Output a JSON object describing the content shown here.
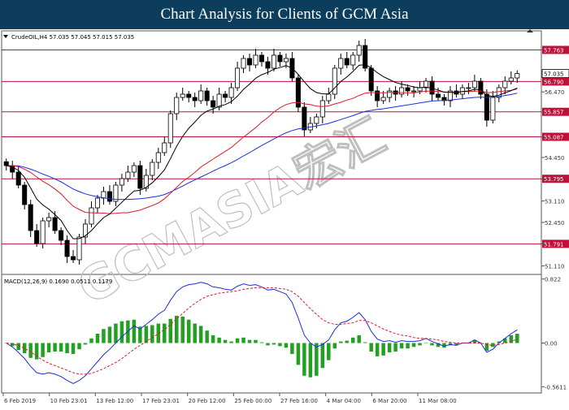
{
  "header": {
    "title": "Chart Analysis for Clients of GCM Asia"
  },
  "watermark": {
    "text": "GCMASIA宏汇"
  },
  "colors": {
    "ma_fast": "#000000",
    "ma_mid": "#e0182c",
    "ma_slow": "#1a2ee0",
    "level_line": "#c0103a",
    "macd_hist": "#22a022",
    "macd_line": "#1a2ee0",
    "macd_signal": "#e0182c",
    "label_bg": "#c0103a",
    "current_bg": "#ffffff"
  },
  "chart_data": [
    {
      "type": "candlestick",
      "instrument_info": "CrudeOIL,H4  57.035 57.045 57.015 57.035",
      "ylim": [
        50.9,
        58.3
      ],
      "y_ticks": [
        51.11,
        51.79,
        52.45,
        53.11,
        53.79,
        54.45,
        55.08,
        55.85,
        56.47,
        57.035,
        57.76
      ],
      "y_tick_labels": [
        "51.110",
        "51.791",
        "52.450",
        "53.110",
        "53.795",
        "54.450",
        "55.087",
        "55.857",
        "56.470",
        "57.035",
        "57.763"
      ],
      "x_tick_labels": [
        "6 Feb 2019",
        "10 Feb 23:01",
        "13 Feb 12:00",
        "17 Feb 23:01",
        "20 Feb 12:00",
        "25 Feb 00:00",
        "27 Feb 16:00",
        "4 Mar 04:00",
        "6 Mar 20:00",
        "11 Mar 08:00"
      ],
      "levels": [
        {
          "value": 57.763,
          "label": "57.763"
        },
        {
          "value": 56.79,
          "label": "56.790"
        },
        {
          "value": 55.857,
          "label": "55.857"
        },
        {
          "value": 55.087,
          "label": "55.087"
        },
        {
          "value": 53.795,
          "label": "53.795"
        },
        {
          "value": 51.791,
          "label": "51.791"
        }
      ],
      "current_price": {
        "value": 57.035,
        "label": "57.035"
      },
      "close": [
        54.2,
        54.0,
        53.6,
        53.0,
        52.2,
        51.8,
        52.5,
        52.6,
        52.2,
        51.9,
        51.4,
        51.3,
        52.0,
        52.4,
        52.9,
        53.2,
        53.4,
        53.1,
        53.6,
        53.8,
        54.0,
        54.2,
        53.5,
        53.9,
        54.3,
        54.6,
        54.9,
        55.8,
        56.3,
        56.4,
        56.3,
        56.2,
        56.5,
        56.2,
        56.0,
        56.4,
        56.3,
        56.6,
        57.2,
        57.5,
        57.3,
        57.6,
        57.4,
        57.2,
        57.6,
        57.4,
        57.5,
        56.9,
        56.0,
        55.3,
        55.5,
        55.7,
        56.2,
        56.4,
        57.2,
        57.5,
        57.3,
        57.6,
        57.9,
        57.2,
        56.5,
        56.2,
        56.3,
        56.5,
        56.4,
        56.6,
        56.5,
        56.5,
        56.6,
        56.8,
        56.4,
        56.3,
        56.2,
        56.5,
        56.4,
        56.6,
        56.6,
        56.8,
        56.4,
        55.6,
        56.3,
        56.6,
        56.8,
        56.9,
        57.035
      ],
      "ma_fast": [
        54.2,
        54.16,
        54.05,
        53.84,
        53.51,
        53.17,
        52.99,
        52.86,
        52.69,
        52.51,
        52.2,
        51.95,
        51.95,
        52.04,
        52.2,
        52.41,
        52.6,
        52.71,
        52.89,
        53.07,
        53.25,
        53.42,
        53.44,
        53.53,
        53.67,
        53.86,
        54.07,
        54.42,
        54.79,
        55.1,
        55.35,
        55.54,
        55.75,
        55.88,
        55.94,
        56.03,
        56.08,
        56.17,
        56.34,
        56.55,
        56.71,
        56.89,
        57.0,
        57.07,
        57.17,
        57.22,
        57.28,
        57.2,
        57.01,
        56.78,
        56.57,
        56.45,
        56.41,
        56.41,
        56.59,
        56.79,
        56.93,
        57.1,
        57.29,
        57.31,
        57.21,
        57.06,
        56.94,
        56.85,
        56.76,
        56.71,
        56.67,
        56.62,
        56.6,
        56.62,
        56.58,
        56.53,
        56.46,
        56.46,
        56.45,
        56.48,
        56.5,
        56.55,
        56.54,
        56.36,
        56.33,
        56.37,
        56.44,
        56.51,
        56.59
      ],
      "ma_mid": [
        54.2,
        54.2,
        54.17,
        54.09,
        53.99,
        53.85,
        53.72,
        53.61,
        53.48,
        53.33,
        53.13,
        52.95,
        52.85,
        52.76,
        52.75,
        52.74,
        52.74,
        52.72,
        52.73,
        52.75,
        52.75,
        52.79,
        52.83,
        52.9,
        52.97,
        53.05,
        53.18,
        53.35,
        53.53,
        53.71,
        53.84,
        53.99,
        54.16,
        54.28,
        54.4,
        54.52,
        54.64,
        54.76,
        54.92,
        55.08,
        55.22,
        55.37,
        55.54,
        55.68,
        55.85,
        55.98,
        56.08,
        56.13,
        56.15,
        56.1,
        56.08,
        56.03,
        56.02,
        56.04,
        56.1,
        56.15,
        56.22,
        56.27,
        56.36,
        56.43,
        56.45,
        56.45,
        56.44,
        56.46,
        56.45,
        56.45,
        56.44,
        56.44,
        56.47,
        56.49,
        56.5,
        56.48,
        56.47,
        56.46,
        56.46,
        56.48,
        56.48,
        56.49,
        56.5,
        56.45,
        56.45,
        56.48,
        56.5,
        56.52,
        56.56
      ],
      "ma_slow": [
        54.2,
        54.2,
        54.19,
        54.15,
        54.09,
        54.02,
        53.94,
        53.87,
        53.79,
        53.7,
        53.59,
        53.48,
        53.4,
        53.33,
        53.28,
        53.24,
        53.21,
        53.18,
        53.16,
        53.16,
        53.16,
        53.17,
        53.18,
        53.2,
        53.23,
        53.26,
        53.31,
        53.39,
        53.48,
        53.57,
        53.67,
        53.76,
        53.85,
        53.94,
        54.03,
        54.12,
        54.2,
        54.29,
        54.39,
        54.5,
        54.6,
        54.71,
        54.82,
        54.92,
        55.02,
        55.12,
        55.21,
        55.28,
        55.33,
        55.36,
        55.39,
        55.42,
        55.46,
        55.5,
        55.56,
        55.62,
        55.68,
        55.74,
        55.81,
        55.87,
        55.9,
        55.93,
        55.95,
        55.98,
        56.01,
        56.04,
        56.07,
        56.1,
        56.13,
        56.16,
        56.19,
        56.2,
        56.21,
        56.22,
        56.24,
        56.26,
        56.28,
        56.3,
        56.31,
        56.3,
        56.31,
        56.33,
        56.36,
        56.39,
        56.43
      ]
    },
    {
      "type": "macd",
      "label": "MACD(12,26,9)  0.1690  0.0511  0.1179",
      "ylim": [
        -0.62,
        0.86
      ],
      "y_ticks": [
        0.822,
        0.0,
        -0.5611
      ],
      "y_tick_labels": [
        "0.822",
        "0.00",
        "-0.5611"
      ],
      "macd": [
        0.0,
        -0.05,
        -0.12,
        -0.2,
        -0.3,
        -0.38,
        -0.4,
        -0.38,
        -0.4,
        -0.43,
        -0.48,
        -0.52,
        -0.48,
        -0.42,
        -0.33,
        -0.24,
        -0.15,
        -0.08,
        0.0,
        0.08,
        0.15,
        0.22,
        0.18,
        0.24,
        0.3,
        0.37,
        0.42,
        0.55,
        0.66,
        0.72,
        0.75,
        0.76,
        0.78,
        0.76,
        0.72,
        0.71,
        0.69,
        0.68,
        0.73,
        0.76,
        0.74,
        0.75,
        0.72,
        0.68,
        0.69,
        0.66,
        0.63,
        0.52,
        0.32,
        0.1,
        0.0,
        -0.05,
        -0.02,
        0.04,
        0.17,
        0.26,
        0.28,
        0.33,
        0.39,
        0.3,
        0.15,
        0.05,
        0.02,
        0.03,
        0.01,
        0.03,
        0.02,
        0.02,
        0.03,
        0.06,
        0.02,
        -0.01,
        -0.04,
        -0.02,
        -0.03,
        0.0,
        0.0,
        0.04,
        0.0,
        -0.12,
        -0.08,
        0.0,
        0.06,
        0.12,
        0.169
      ],
      "signal": [
        0.0,
        -0.01,
        -0.03,
        -0.07,
        -0.11,
        -0.17,
        -0.22,
        -0.26,
        -0.29,
        -0.32,
        -0.35,
        -0.38,
        -0.4,
        -0.4,
        -0.39,
        -0.36,
        -0.33,
        -0.29,
        -0.25,
        -0.2,
        -0.14,
        -0.08,
        -0.03,
        0.02,
        0.07,
        0.12,
        0.17,
        0.24,
        0.31,
        0.38,
        0.45,
        0.51,
        0.56,
        0.6,
        0.62,
        0.64,
        0.65,
        0.66,
        0.67,
        0.69,
        0.7,
        0.71,
        0.71,
        0.71,
        0.71,
        0.7,
        0.69,
        0.66,
        0.6,
        0.52,
        0.44,
        0.37,
        0.3,
        0.26,
        0.24,
        0.24,
        0.25,
        0.26,
        0.29,
        0.29,
        0.26,
        0.22,
        0.18,
        0.15,
        0.12,
        0.1,
        0.09,
        0.07,
        0.06,
        0.06,
        0.05,
        0.04,
        0.02,
        0.01,
        0.0,
        0.0,
        0.0,
        0.0,
        0.0,
        -0.02,
        -0.03,
        -0.02,
        0.0,
        0.02,
        0.05
      ],
      "histogram": [
        0.0,
        -0.04,
        -0.09,
        -0.13,
        -0.19,
        -0.21,
        -0.18,
        -0.12,
        -0.11,
        -0.11,
        -0.13,
        -0.14,
        -0.08,
        -0.02,
        0.06,
        0.12,
        0.18,
        0.21,
        0.25,
        0.28,
        0.29,
        0.3,
        0.21,
        0.22,
        0.23,
        0.25,
        0.25,
        0.31,
        0.35,
        0.34,
        0.3,
        0.25,
        0.22,
        0.16,
        0.1,
        0.07,
        0.04,
        0.02,
        0.06,
        0.07,
        0.04,
        0.04,
        0.01,
        -0.03,
        -0.02,
        -0.04,
        -0.06,
        -0.14,
        -0.28,
        -0.42,
        -0.44,
        -0.42,
        -0.32,
        -0.22,
        -0.07,
        0.02,
        0.03,
        0.07,
        0.1,
        0.01,
        -0.11,
        -0.17,
        -0.16,
        -0.12,
        -0.11,
        -0.07,
        -0.07,
        -0.05,
        -0.03,
        0.0,
        -0.03,
        -0.05,
        -0.06,
        -0.03,
        -0.03,
        0.0,
        0.0,
        0.04,
        0.0,
        -0.1,
        -0.05,
        0.02,
        0.06,
        0.1,
        0.119
      ]
    }
  ]
}
